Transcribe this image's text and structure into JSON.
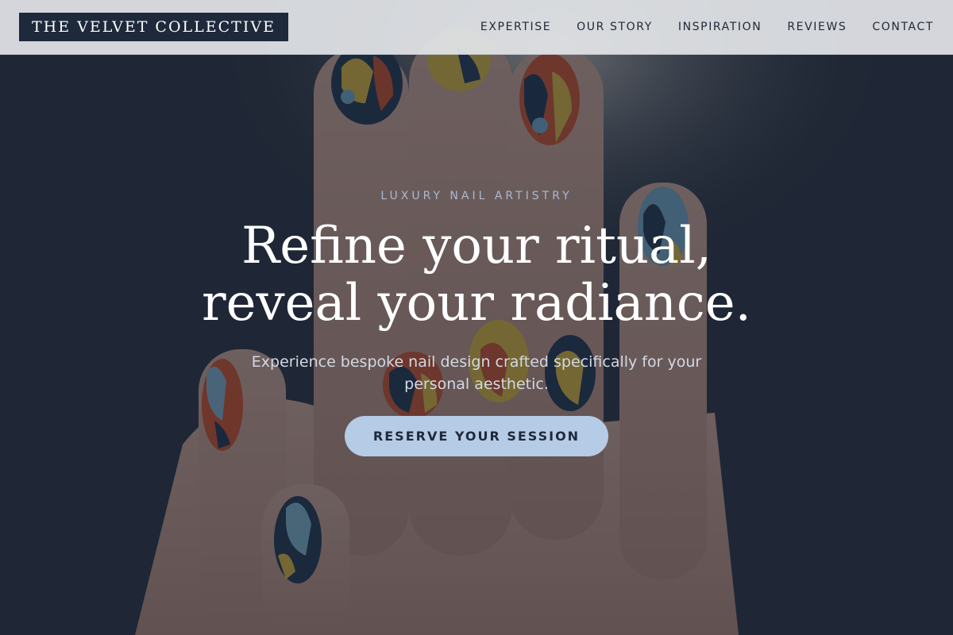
{
  "header": {
    "logo_text": "THE VELVET COLLECTIVE",
    "nav": [
      {
        "label": "EXPERTISE"
      },
      {
        "label": "OUR STORY"
      },
      {
        "label": "INSPIRATION"
      },
      {
        "label": "REVIEWS"
      },
      {
        "label": "CONTACT"
      }
    ]
  },
  "hero": {
    "eyebrow": "LUXURY NAIL ARTISTRY",
    "title": "Refine your ritual, reveal your radiance.",
    "subtitle": "Experience bespoke nail design crafted specifically for your personal aesthetic.",
    "cta_label": "RESERVE YOUR SESSION",
    "background_image": "hand-with-multicolor-nail-art"
  },
  "colors": {
    "header_bg": "#e2e4e7",
    "logo_bg": "#1e293b",
    "overlay": "#18202e",
    "cta_bg": "#b6cbe5",
    "cta_text": "#1e293b",
    "eyebrow": "#a9b8cf"
  }
}
